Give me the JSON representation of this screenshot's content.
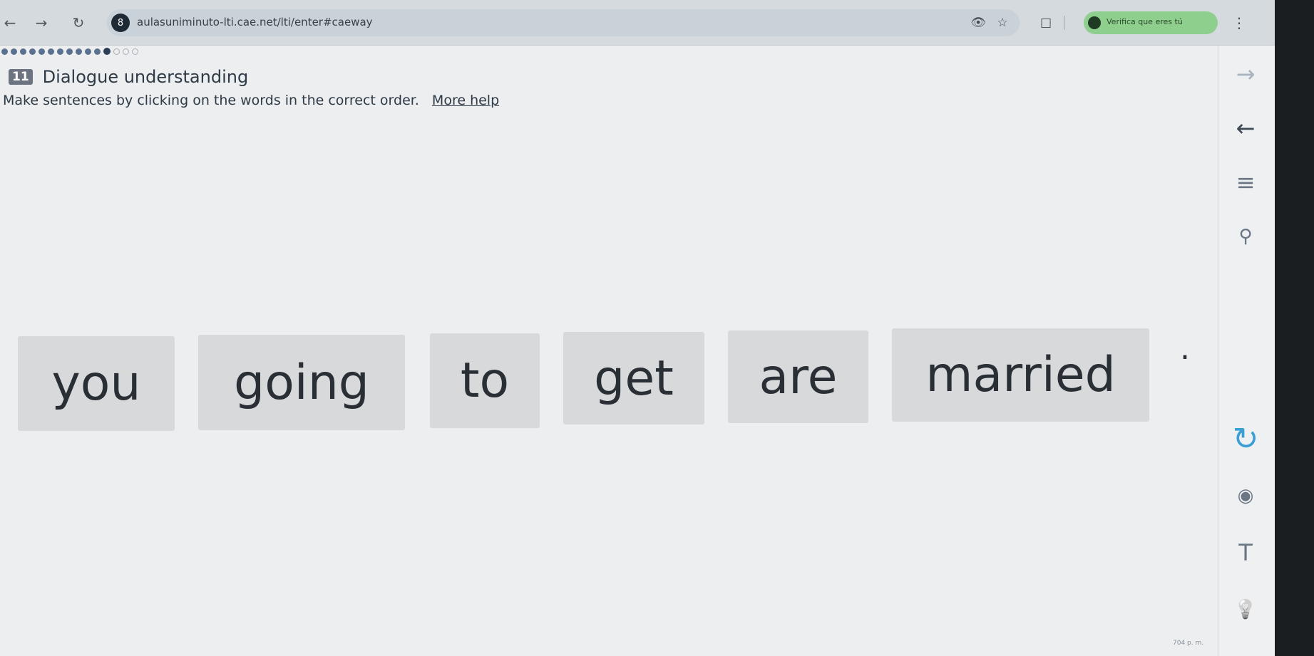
{
  "browser": {
    "back": "←",
    "forward": "→",
    "reload": "↻",
    "site_badge": "8",
    "url": "aulasuniminuto-lti.cae.net/lti/enter#caeway",
    "icons": [
      "eye-off-icon",
      "star-icon",
      "extension-icon",
      "menu-dots-icon"
    ],
    "profile_text": "Verifica que eres tú",
    "menu": "⋮"
  },
  "progress": {
    "done": 11,
    "current": 1,
    "remaining": 3
  },
  "exercise": {
    "number": "11",
    "title": "Dialogue understanding",
    "instructions": "Make sentences by clicking on the words in the correct order.",
    "more_help": "More help"
  },
  "words": [
    "you",
    "going",
    "to",
    "get",
    "are",
    "married"
  ],
  "period": ".",
  "toolbar": {
    "next": "→",
    "back": "←",
    "list": "≡",
    "hint": "⚲",
    "refresh": "↻",
    "view": "◉",
    "text_size": "T",
    "bulb": "💡"
  },
  "status": "704 p. m."
}
